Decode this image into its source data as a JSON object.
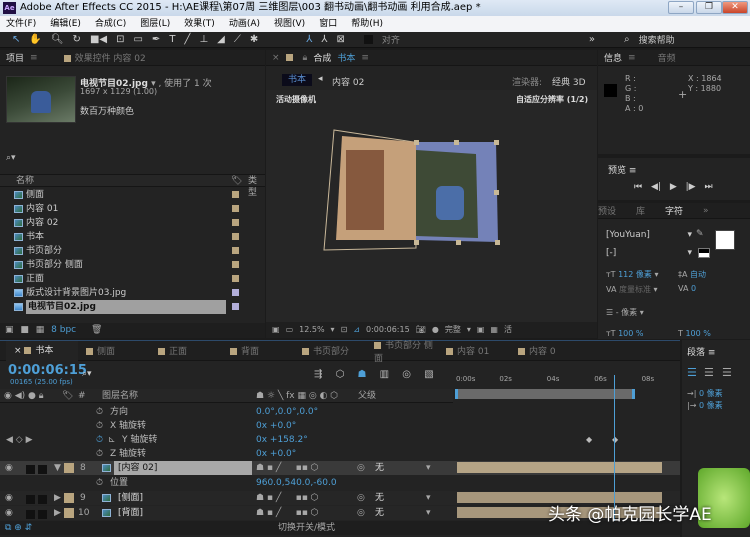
{
  "window": {
    "title": "Adobe After Effects CC 2015 - H:\\AE课程\\第07周 三维图层\\003 翻书动画\\翻书动画 利用合成.aep *",
    "logo": "Ae",
    "minimize": "–",
    "restore": "❐",
    "close": "✕"
  },
  "menu": [
    "文件(F)",
    "编辑(E)",
    "合成(C)",
    "图层(L)",
    "效果(T)",
    "动画(A)",
    "视图(V)",
    "窗口",
    "帮助(H)"
  ],
  "toolbar": {
    "snap_label": "对齐",
    "more": "»",
    "search_help": "搜索帮助"
  },
  "project": {
    "tab": "项目",
    "effects_tab": "效果控件 内容 02",
    "preview_name": "电视节目02.jpg",
    "used": "▾ , 使用了 1 次",
    "dimensions": "1697 x 1129 (1.00)",
    "colors": "数百万种颜色",
    "col_name": "名称",
    "col_type": "类型",
    "bpc": "8 bpc",
    "items": [
      {
        "name": "侧面",
        "kind": "comp"
      },
      {
        "name": "内容 01",
        "kind": "comp"
      },
      {
        "name": "内容 02",
        "kind": "comp"
      },
      {
        "name": "书本",
        "kind": "comp"
      },
      {
        "name": "书页部分",
        "kind": "comp"
      },
      {
        "name": "书页部分 侧面",
        "kind": "comp"
      },
      {
        "name": "正面",
        "kind": "comp"
      },
      {
        "name": "版式设计背景图片03.jpg",
        "kind": "image"
      },
      {
        "name": "电视节目02.jpg",
        "kind": "image",
        "selected": true
      }
    ]
  },
  "comp": {
    "tab_prefix": "合成",
    "tab_name": "书本",
    "crumb_active": "书本",
    "crumb_next": "内容 02",
    "renderer_label": "渲染器:",
    "renderer": "经典 3D",
    "camera": "活动摄像机",
    "resolution_note": "自适应分辨率 (1/2)",
    "zoom": "12.5%",
    "timecode": "0:00:06:15",
    "quality": "完整",
    "active_cam_short": "活"
  },
  "info": {
    "tab": "信息",
    "audio_tab": "音频",
    "r": "R :",
    "g": "G :",
    "b": "B :",
    "a": "A : 0",
    "x": "X : 1864",
    "y": "Y : 1880"
  },
  "preview": {
    "tab": "预览"
  },
  "character": {
    "tabs": [
      "预设",
      "库",
      "字符"
    ],
    "font": "[YouYuan]",
    "style": "[-]",
    "size": "112 像素",
    "leading": "自动",
    "kerning": "度量标准",
    "tracking": "0",
    "stroke": "- 像素",
    "vscale": "100 %",
    "hscale": "100 %"
  },
  "paragraph": {
    "tab": "段落",
    "indent1": "0 像素",
    "indent2": "0 像素"
  },
  "timeline": {
    "tabs": [
      "书本",
      "侧面",
      "正面",
      "背面",
      "书页部分",
      "书页部分 侧面",
      "内容 01",
      "内容 0"
    ],
    "timecode": "0:00:06:15",
    "frames": "00165 (25.00 fps)",
    "col_layer_name": "图层名称",
    "col_parent": "父级",
    "col_num": "#",
    "toggle_label": "切换开关/模式",
    "ruler": [
      "0:00s",
      "02s",
      "04s",
      "06s",
      "08s"
    ],
    "playhead_seconds": 6.6,
    "props_top": [
      {
        "name": "方向",
        "value": "0.0°,0.0°,0.0°"
      },
      {
        "name": "X 轴旋转",
        "value": "0x +0.0°"
      },
      {
        "name": "Y 轴旋转",
        "value": "0x +158.2°"
      },
      {
        "name": "Z 轴旋转",
        "value": "0x +0.0°"
      }
    ],
    "layer8": {
      "num": "8",
      "name": "[内容 02]",
      "parent": "无"
    },
    "position": {
      "name": "位置",
      "value": "960.0,540.0,-60.0"
    },
    "layer9": {
      "num": "9",
      "name": "[侧面]",
      "parent": "无"
    },
    "layer10": {
      "num": "10",
      "name": "[背面]",
      "parent": "无"
    }
  },
  "watermark": "头条 @帕克园长学AE"
}
